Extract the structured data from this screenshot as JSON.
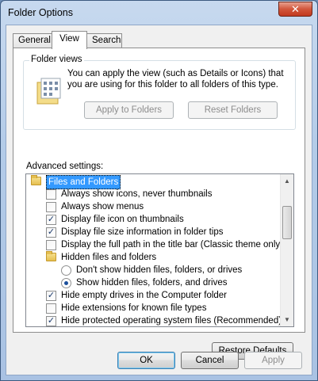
{
  "window": {
    "title": "Folder Options",
    "close_glyph": "✕"
  },
  "tabs": [
    "General",
    "View",
    "Search"
  ],
  "folder_views": {
    "legend": "Folder views",
    "description": "You can apply the view (such as Details or Icons) that you are using for this folder to all folders of this type.",
    "apply_button": "Apply to Folders",
    "reset_button": "Reset Folders"
  },
  "advanced": {
    "label": "Advanced settings:",
    "items": [
      {
        "type": "folder",
        "label": "Files and Folders",
        "selected": true
      },
      {
        "type": "checkbox",
        "label": "Always show icons, never thumbnails",
        "checked": false
      },
      {
        "type": "checkbox",
        "label": "Always show menus",
        "checked": false
      },
      {
        "type": "checkbox",
        "label": "Display file icon on thumbnails",
        "checked": true
      },
      {
        "type": "checkbox",
        "label": "Display file size information in folder tips",
        "checked": true
      },
      {
        "type": "checkbox",
        "label": "Display the full path in the title bar (Classic theme only)",
        "checked": false
      },
      {
        "type": "folder",
        "label": "Hidden files and folders"
      },
      {
        "type": "radio",
        "label": "Don't show hidden files, folders, or drives",
        "checked": false
      },
      {
        "type": "radio",
        "label": "Show hidden files, folders, and drives",
        "checked": true
      },
      {
        "type": "checkbox",
        "label": "Hide empty drives in the Computer folder",
        "checked": true
      },
      {
        "type": "checkbox",
        "label": "Hide extensions for known file types",
        "checked": false
      },
      {
        "type": "checkbox",
        "label": "Hide protected operating system files (Recommended)",
        "checked": true
      }
    ]
  },
  "restore_defaults_button": "Restore Defaults",
  "footer": {
    "ok": "OK",
    "cancel": "Cancel",
    "apply": "Apply"
  }
}
